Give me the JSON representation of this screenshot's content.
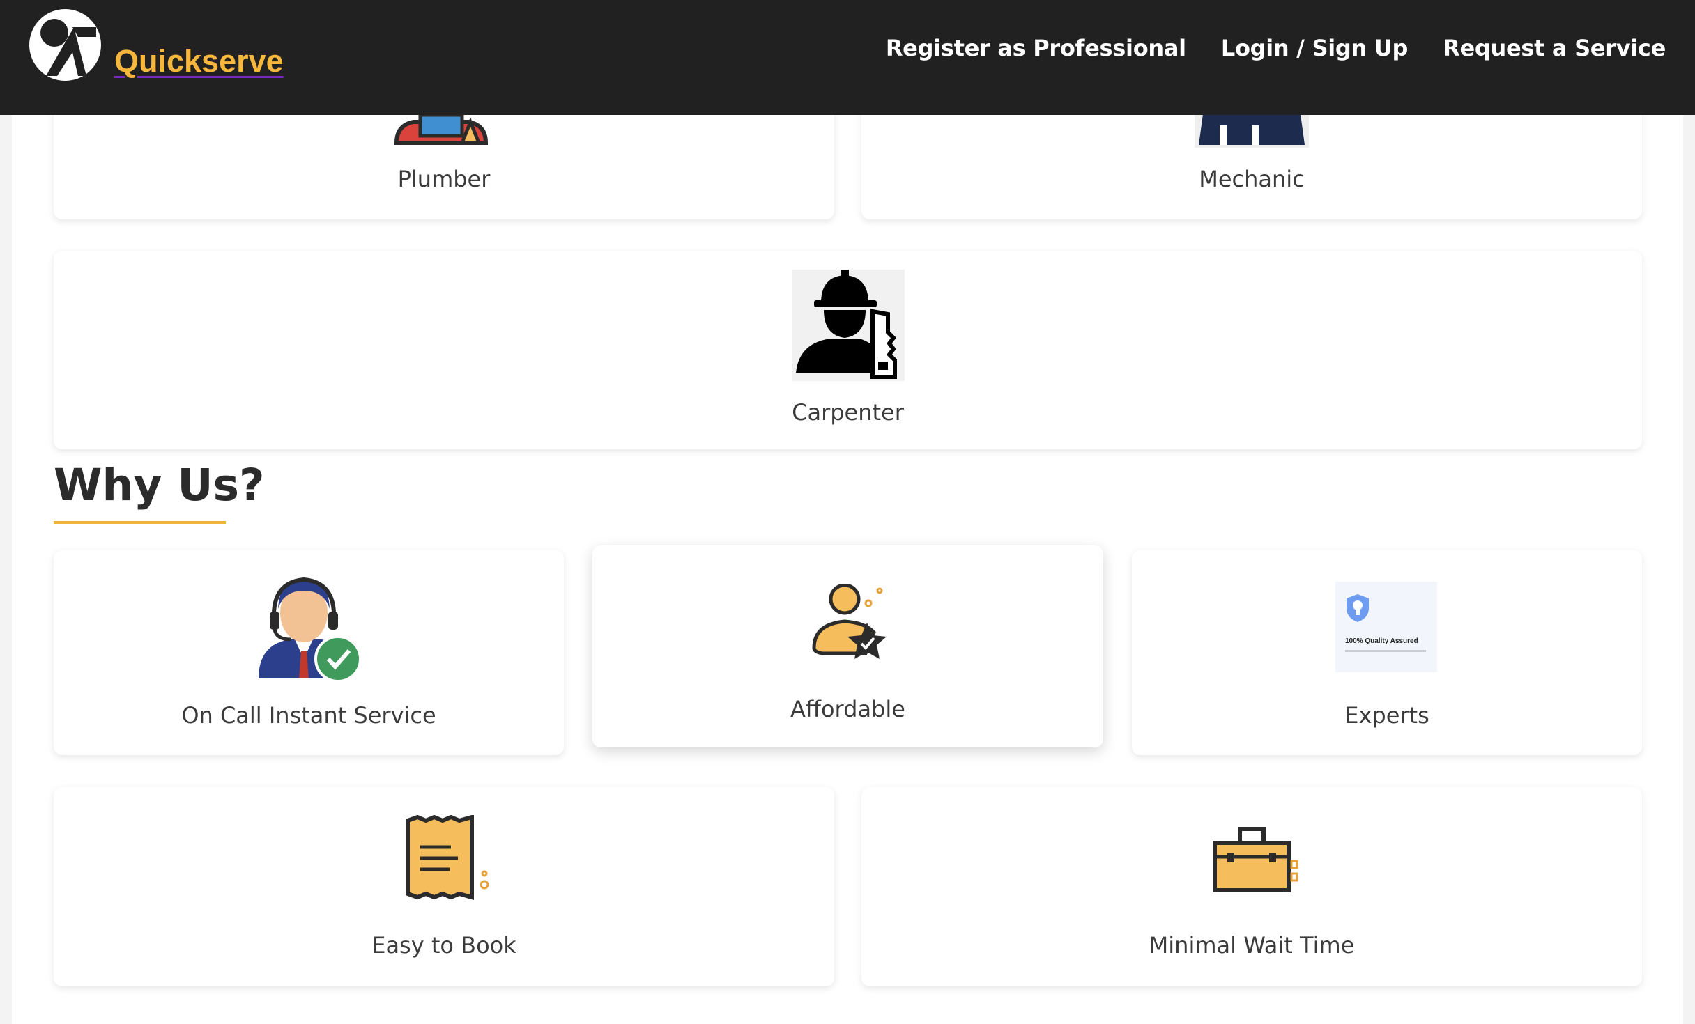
{
  "navbar": {
    "brand": "Quickserve",
    "links": [
      "Register as Professional",
      "Login / Sign Up",
      "Request a Service"
    ]
  },
  "services": {
    "plumber": "Plumber",
    "mechanic": "Mechanic",
    "carpenter": "Carpenter"
  },
  "why_us": {
    "title": "Why Us?",
    "features": [
      "On Call Instant Service",
      "Affordable",
      "Experts",
      "Easy to Book",
      "Minimal Wait Time"
    ],
    "experts_image_text": "100% Quality Assured"
  },
  "colors": {
    "navbar_bg": "#212121",
    "brand": "#f6b73c",
    "accent_underline": "#f0b43a",
    "icon_orange": "#f5bd5c"
  }
}
